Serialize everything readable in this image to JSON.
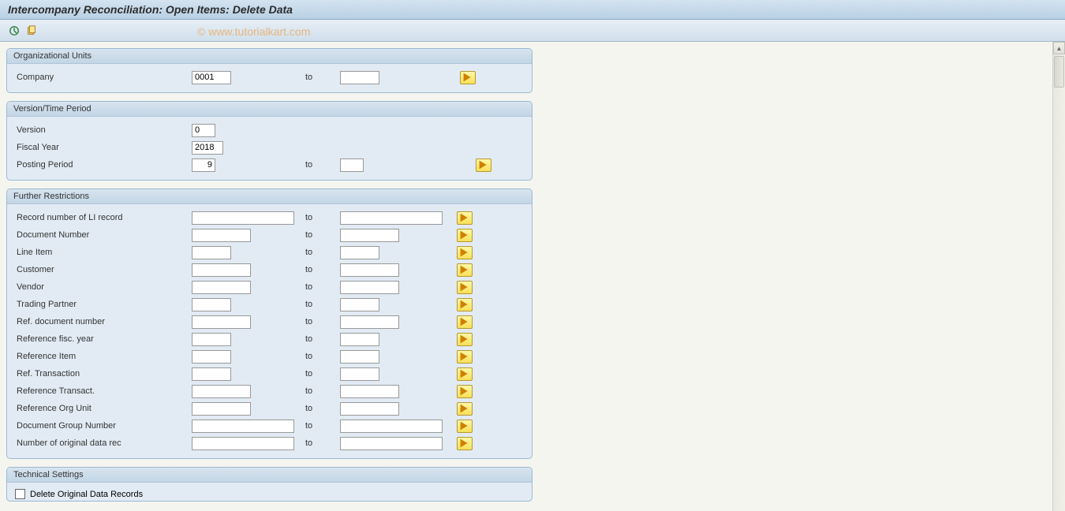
{
  "title": "Intercompany Reconciliation: Open Items: Delete Data",
  "watermark": "© www.tutorialkart.com",
  "labels": {
    "to": "to"
  },
  "groups": {
    "org": {
      "title": "Organizational Units",
      "company_label": "Company",
      "company_from": "0001",
      "company_to": ""
    },
    "version": {
      "title": "Version/Time Period",
      "version_label": "Version",
      "version_value": "0",
      "fiscal_year_label": "Fiscal Year",
      "fiscal_year_value": "2018",
      "posting_period_label": "Posting Period",
      "posting_period_from": "9",
      "posting_period_to": ""
    },
    "restrictions": {
      "title": "Further Restrictions",
      "fields": [
        {
          "label": "Record number of LI record",
          "width": "wide"
        },
        {
          "label": "Document Number",
          "width": "medium"
        },
        {
          "label": "Line Item",
          "width": "narrow"
        },
        {
          "label": "Customer",
          "width": "medium"
        },
        {
          "label": "Vendor",
          "width": "medium"
        },
        {
          "label": "Trading Partner",
          "width": "narrow"
        },
        {
          "label": "Ref. document number",
          "width": "medium"
        },
        {
          "label": "Reference fisc. year",
          "width": "narrow"
        },
        {
          "label": "Reference Item",
          "width": "narrow"
        },
        {
          "label": "Ref. Transaction",
          "width": "narrow"
        },
        {
          "label": "Reference Transact.",
          "width": "medium"
        },
        {
          "label": "Reference Org Unit",
          "width": "medium"
        },
        {
          "label": "Document Group Number",
          "width": "wide"
        },
        {
          "label": "Number of original data rec",
          "width": "wide"
        }
      ]
    },
    "technical": {
      "title": "Technical Settings",
      "delete_original_label": "Delete Original Data Records"
    }
  }
}
